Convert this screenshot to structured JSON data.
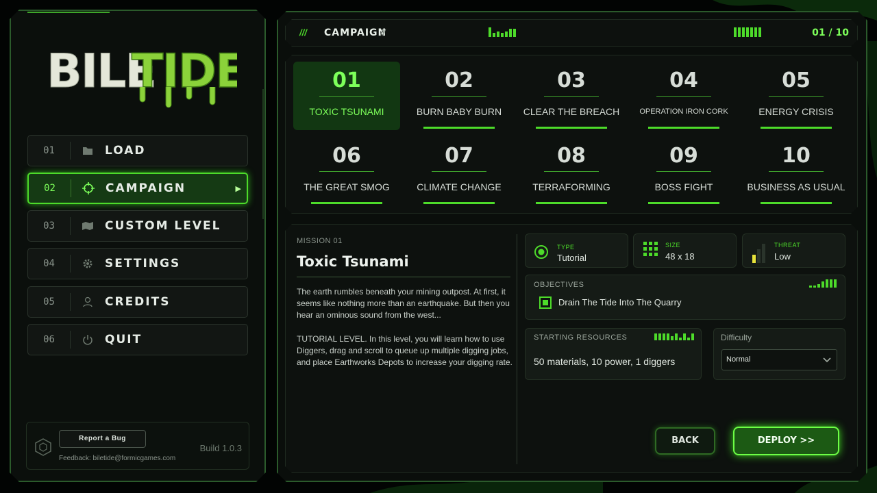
{
  "logo": {
    "text_a": "BILE",
    "text_b": "TIDE"
  },
  "menu": [
    {
      "num": "01",
      "label": "LOAD",
      "icon": "folder-icon"
    },
    {
      "num": "02",
      "label": "CAMPAIGN",
      "icon": "crosshair-icon",
      "active": true
    },
    {
      "num": "03",
      "label": "CUSTOM LEVEL",
      "icon": "map-icon"
    },
    {
      "num": "04",
      "label": "SETTINGS",
      "icon": "gear-icon"
    },
    {
      "num": "05",
      "label": "CREDITS",
      "icon": "person-icon"
    },
    {
      "num": "06",
      "label": "QUIT",
      "icon": "power-icon"
    }
  ],
  "footer": {
    "bug_button": "Report a Bug",
    "feedback": "Feedback: biletide@formicgames.com",
    "build": "Build 1.0.3"
  },
  "topbar": {
    "prefix": "///",
    "title": "CAMPAIGN",
    "suffix": "//",
    "page": "01 / 10"
  },
  "missions": [
    {
      "num": "01",
      "name": "TOXIC TSUNAMI",
      "active": true
    },
    {
      "num": "02",
      "name": "BURN BABY BURN"
    },
    {
      "num": "03",
      "name": "CLEAR THE BREACH"
    },
    {
      "num": "04",
      "name": "OPERATION IRON CORK"
    },
    {
      "num": "05",
      "name": "ENERGY CRISIS"
    },
    {
      "num": "06",
      "name": "THE GREAT SMOG"
    },
    {
      "num": "07",
      "name": "CLIMATE CHANGE"
    },
    {
      "num": "08",
      "name": "TERRAFORMING"
    },
    {
      "num": "09",
      "name": "BOSS FIGHT"
    },
    {
      "num": "10",
      "name": "BUSINESS AS USUAL"
    }
  ],
  "details": {
    "label": "MISSION 01",
    "title": "Toxic Tsunami",
    "desc1": "The earth rumbles beneath your mining outpost. At first, it seems like nothing more than an earthquake. But then you hear an ominous sound from the west...",
    "desc2": "TUTORIAL LEVEL. In this level, you will learn how to use Diggers, drag and scroll to queue up multiple digging jobs, and place Earthworks Depots to increase your digging rate.",
    "type_label": "TYPE",
    "type_value": "Tutorial",
    "size_label": "SIZE",
    "size_value": "48 x 18",
    "threat_label": "THREAT",
    "threat_value": "Low",
    "objectives_label": "OBJECTIVES",
    "objective": "Drain The Tide Into The Quarry",
    "resources_label": "STARTING RESOURCES",
    "resources": "50 materials, 10 power, 1 diggers",
    "difficulty_label": "Difficulty",
    "difficulty_value": "Normal",
    "back": "BACK",
    "deploy": "DEPLOY >>"
  },
  "colors": {
    "accent": "#4ddb2a",
    "accent_bright": "#7dff5a",
    "threat": "#e6e23a"
  }
}
